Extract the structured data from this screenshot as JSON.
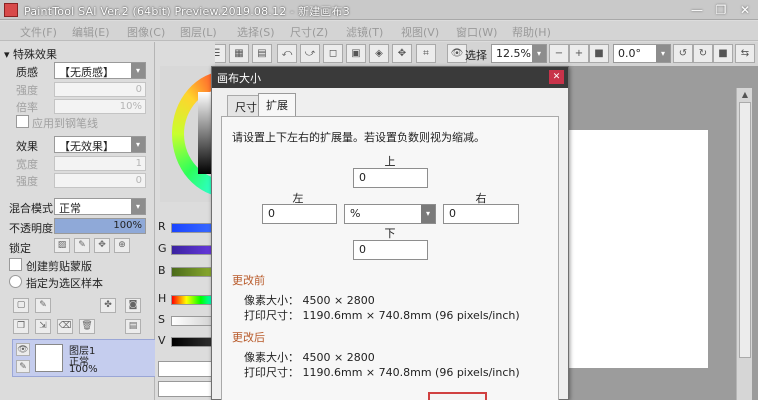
{
  "window": {
    "title": "PaintTool SAI Ver.2 (64bit) Preview.2019.08.12 - 新建画布3",
    "minimize": "—",
    "restore": "❐",
    "close": "✕"
  },
  "menubar": [
    "文件(F)",
    "编辑(E)",
    "图像(C)",
    "图层(L)",
    "选择(S)",
    "尺寸(Z)",
    "滤镜(T)",
    "视图(V)",
    "窗口(W)",
    "帮助(H)"
  ],
  "toolbar": {
    "select_label": "选择",
    "zoom": "12.5%",
    "rotation": "0.0°"
  },
  "left_panel": {
    "special_effects": "▾ 特殊效果",
    "texture_label": "质感",
    "texture_value": "【无质感】",
    "strength_label": "强度",
    "strength_value": "0",
    "scale_label": "倍率",
    "scale_value": "10%",
    "apply_pen": "应用到钢笔线",
    "effect_label": "效果",
    "effect_value": "【无效果】",
    "width_label": "宽度",
    "width_value": "1",
    "effect_strength_label": "强度",
    "effect_strength_value": "0",
    "blend_label": "混合模式",
    "blend_value": "正常",
    "opacity_label": "不透明度",
    "opacity_value": "100%",
    "opacity_fraction": 1.0,
    "lock_label": "锁定",
    "clipping_label": "创建剪贴蒙版",
    "selection_source_label": "指定为选区样本",
    "layer": {
      "name": "图层1",
      "mode": "正常",
      "opacity": "100%"
    }
  },
  "color_panel": {
    "sliders": [
      "R",
      "G",
      "B",
      "H",
      "S",
      "V"
    ]
  },
  "dialog": {
    "title": "画布大小",
    "close": "✕",
    "tabs": [
      "尺寸",
      "扩展"
    ],
    "active_tab": "扩展",
    "description": "请设置上下左右的扩展量。若设置负数则视为缩减。",
    "top_label": "上",
    "top_value": "0",
    "left_label": "左",
    "left_value": "0",
    "unit": "%",
    "right_label": "右",
    "right_value": "0",
    "bottom_label": "下",
    "bottom_value": "0",
    "before_title": "更改前",
    "before_pixels": "像素大小： 4500 × 2800",
    "before_print": "打印尺寸： 1190.6mm × 740.8mm (96 pixels/inch)",
    "after_title": "更改后",
    "after_pixels": "像素大小： 4500 × 2800",
    "after_print": "打印尺寸： 1190.6mm × 740.8mm (96 pixels/inch)"
  },
  "colors": {
    "accent": "#c8334a",
    "section": "#b85a2a",
    "layer_selected": "#c5cdee"
  }
}
